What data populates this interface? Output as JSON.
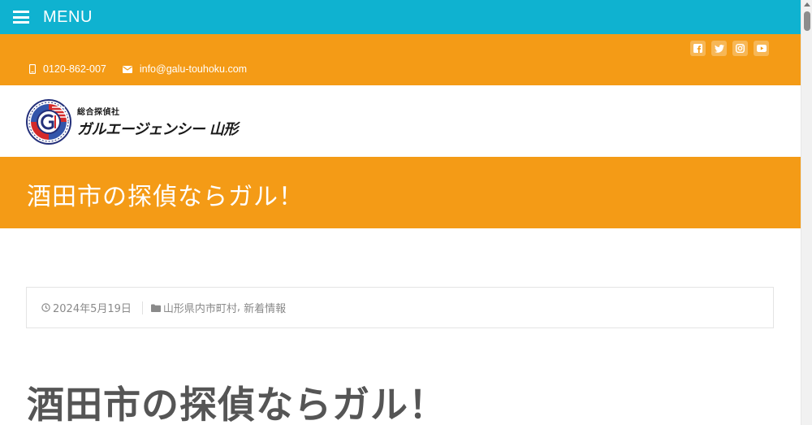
{
  "menu": {
    "label": "MENU"
  },
  "contact": {
    "phone": "0120-862-007",
    "email": "info@galu-touhoku.com"
  },
  "social": [
    "facebook-icon",
    "twitter-icon",
    "instagram-icon",
    "youtube-icon"
  ],
  "logo": {
    "small": "総合探偵社",
    "big": "ガルエージェンシー 山形"
  },
  "banner": {
    "title": "酒田市の探偵ならガル！"
  },
  "meta": {
    "date": "2024年5月19日",
    "category1": "山形県内市町村",
    "separator": ",",
    "category2": "新着情報"
  },
  "post": {
    "title": "酒田市の探偵ならガル！"
  },
  "colors": {
    "menu_bar": "#0fb2d0",
    "accent": "#f49b16",
    "meta_text": "#8a8a8a",
    "title_text": "#555555"
  }
}
